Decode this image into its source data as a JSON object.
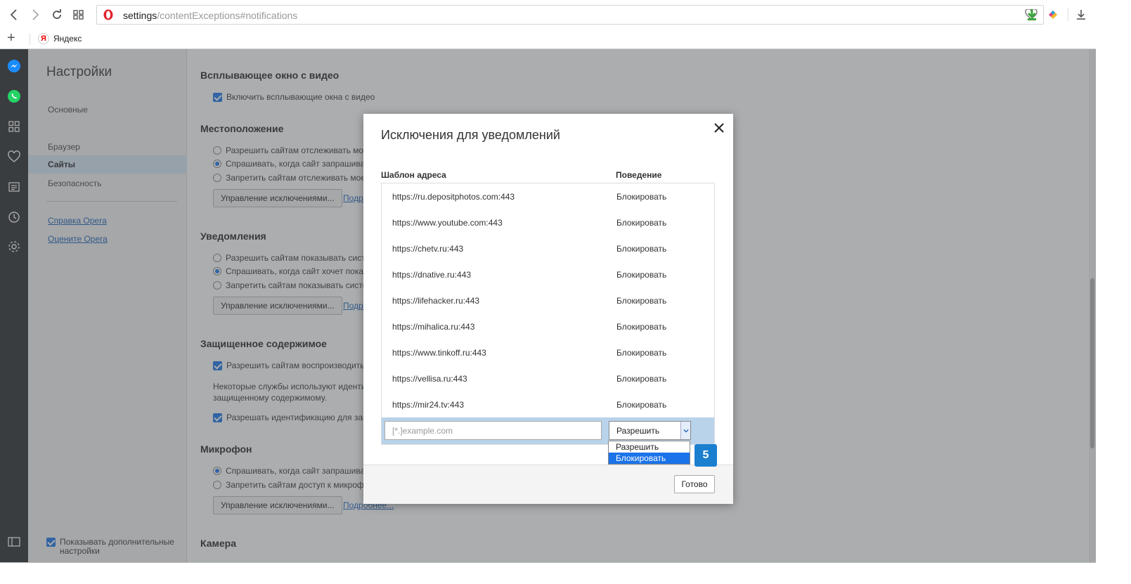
{
  "address": {
    "host": "settings",
    "path": "/contentExceptions#notifications"
  },
  "bookmarks": {
    "yandex_label": "Яндекс"
  },
  "nav": {
    "title": "Настройки",
    "items": [
      {
        "label": "Основные"
      },
      {
        "label": "Браузер"
      },
      {
        "label": "Сайты"
      },
      {
        "label": "Безопасность"
      }
    ],
    "links": [
      {
        "label": "Справка Opera"
      },
      {
        "label": "Оцените Opera"
      }
    ],
    "show_advanced": "Показывать дополнительные настройки"
  },
  "content": {
    "video_popup": {
      "title": "Всплывающее окно с видео",
      "option": "Включить всплывающие окна с видео"
    },
    "location": {
      "title": "Местоположение",
      "options": [
        "Разрешить сайтам отслеживать мое",
        "Спрашивать, когда сайт запрашивае",
        "Запретить сайтам отслеживать мое"
      ],
      "manage": "Управление исключениями...",
      "more": "Подро"
    },
    "notifications": {
      "title": "Уведомления",
      "options": [
        "Разрешить сайтам показывать систе",
        "Спрашивать, когда сайт хочет показ",
        "Запретить сайтам показывать систем"
      ],
      "manage": "Управление исключениями...",
      "more": "Подро"
    },
    "protected": {
      "title": "Защищенное содержимое",
      "option1": "Разрешить сайтам воспроизводить з",
      "paragraph": "Некоторые службы используют идентиф защищенному содержимому.",
      "option2": "Разрешать идентификацию для защ"
    },
    "microphone": {
      "title": "Микрофон",
      "options": [
        "Спрашивать, когда сайт запрашивае",
        "Запретить сайтам доступ к микрофо"
      ],
      "manage": "Управление исключениями...",
      "more": "Подробнее..."
    },
    "camera": {
      "title": "Камера"
    }
  },
  "modal": {
    "title": "Исключения для уведомлений",
    "col_pattern": "Шаблон адреса",
    "col_behavior": "Поведение",
    "rows": [
      {
        "url": "https://ru.depositphotos.com:443",
        "behavior": "Блокировать"
      },
      {
        "url": "https://www.youtube.com:443",
        "behavior": "Блокировать"
      },
      {
        "url": "https://chetv.ru:443",
        "behavior": "Блокировать"
      },
      {
        "url": "https://dnative.ru:443",
        "behavior": "Блокировать"
      },
      {
        "url": "https://lifehacker.ru:443",
        "behavior": "Блокировать"
      },
      {
        "url": "https://mihalica.ru:443",
        "behavior": "Блокировать"
      },
      {
        "url": "https://www.tinkoff.ru:443",
        "behavior": "Блокировать"
      },
      {
        "url": "https://vellisa.ru:443",
        "behavior": "Блокировать"
      },
      {
        "url": "https://mir24.tv:443",
        "behavior": "Блокировать"
      }
    ],
    "input_placeholder": "[*.]example.com",
    "select_value": "Разрешить",
    "dropdown_options": [
      "Разрешить",
      "Блокировать"
    ],
    "done": "Готово"
  },
  "badge": "5",
  "colors": {
    "accent": "#1a73e8",
    "badge": "#1b7fd0",
    "opera_red": "#e0222a"
  }
}
